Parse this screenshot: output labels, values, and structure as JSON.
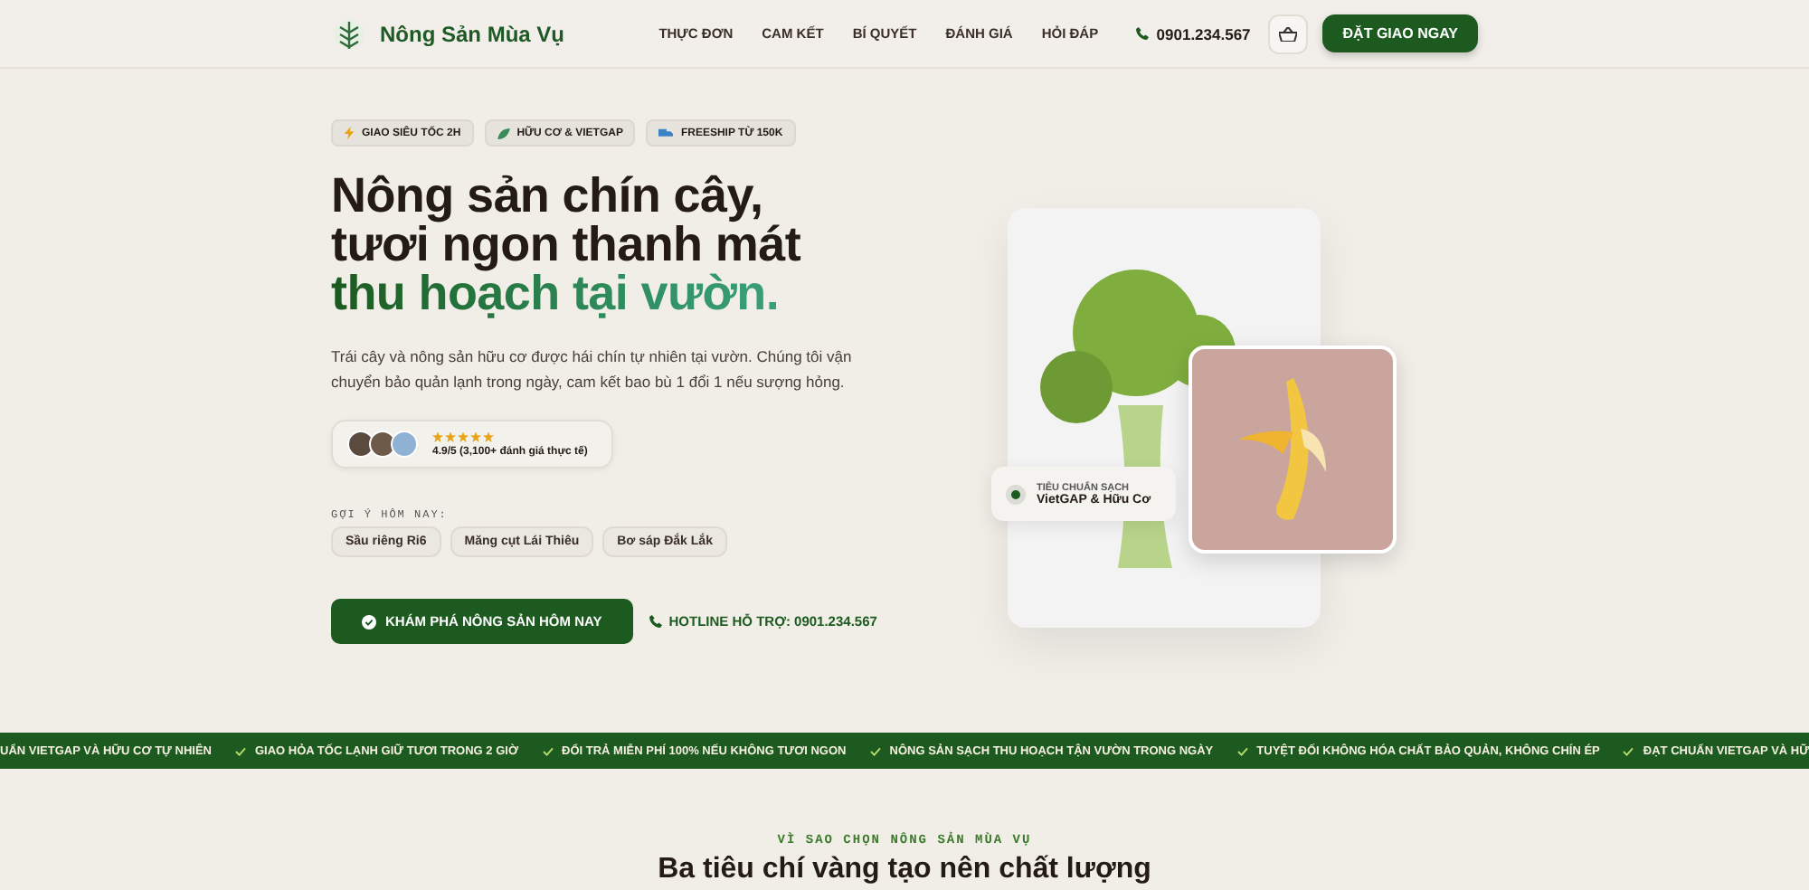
{
  "header": {
    "brand": "Nông Sản Mùa Vụ",
    "nav": [
      {
        "label": "THỰC ĐƠN"
      },
      {
        "label": "CAM KẾT"
      },
      {
        "label": "BÍ QUYẾT"
      },
      {
        "label": "ĐÁNH GIÁ"
      },
      {
        "label": "HỎI ĐÁP"
      }
    ],
    "phone": "0901.234.567",
    "cta": "ĐẶT GIAO NGAY"
  },
  "hero": {
    "badges": [
      {
        "kind": "bolt",
        "label": "GIAO SIÊU TỐC 2H"
      },
      {
        "kind": "leaf",
        "label": "HỮU CƠ & VIETGAP"
      },
      {
        "kind": "truck",
        "label": "FREESHIP TỪ 150K"
      }
    ],
    "headline": [
      {
        "kind": "dark",
        "text": "Nông sản chín cây,"
      },
      {
        "kind": "dark",
        "text": "tươi ngon thanh mát"
      },
      {
        "kind": "accent",
        "text": "thu hoạch tại vườn."
      }
    ],
    "description": "Trái cây và nông sản hữu cơ được hái chín tự nhiên tại vườn. Chúng tôi vận chuyển bảo quản lạnh trong ngày, cam kết bao bù 1 đổi 1 nếu sượng hỏng.",
    "rating": {
      "stars": 5,
      "text": "4.9/5 (3,100+ đánh giá thực tế)"
    },
    "suggest_label": "GỢI Ý HÔM NAY:",
    "suggestions": [
      "Sầu riêng Ri6",
      "Măng cụt Lái Thiêu",
      "Bơ sáp Đắk Lắk"
    ],
    "primary_button": "KHÁM PHÁ NÔNG SẢN HÔM NAY",
    "hotline": "HOTLINE HỖ TRỢ: 0901.234.567",
    "standard_card": {
      "title": "TIÊU CHUẨN SẠCH",
      "subtitle": "VietGAP & Hữu Cơ"
    }
  },
  "ticker": [
    "UẨN VIETGAP VÀ HỮU CƠ TỰ NHIÊN",
    "GIAO HỎA TỐC LẠNH GIỮ TƯƠI TRONG 2 GIỜ",
    "ĐỔI TRẢ MIỄN PHÍ 100% NẾU KHÔNG TƯƠI NGON",
    "NÔNG SẢN SẠCH THU HOẠCH TẬN VƯỜN TRONG NGÀY",
    "TUYỆT ĐỐI KHÔNG HÓA CHẤT BẢO QUẢN, KHÔNG CHÍN ÉP",
    "ĐẠT CHUẨN VIETGAP VÀ HỮ"
  ],
  "section": {
    "eyebrow": "VÌ SAO CHỌN NÔNG SẢN MÙA VỤ",
    "title": "Ba tiêu chí vàng tạo nên chất lượng"
  }
}
